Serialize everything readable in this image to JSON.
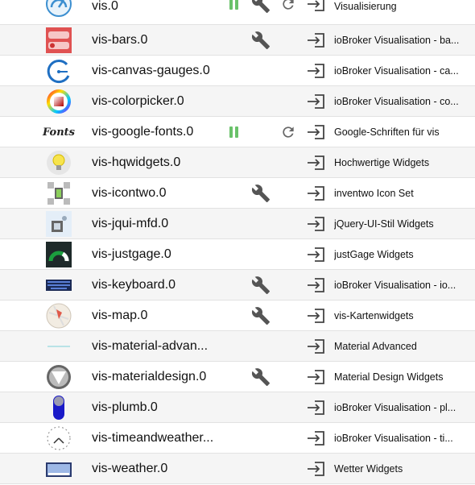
{
  "colors": {
    "pause": "#6ac26a",
    "icon": "#555555",
    "row_alt": "#f5f5f5"
  },
  "adapters": [
    {
      "name": "vis.0",
      "title": "Visualisierung",
      "icon": "speedometer-icon",
      "pause": true,
      "wrench": true,
      "reload": true
    },
    {
      "name": "vis-bars.0",
      "title": "ioBroker Visualisation - ba...",
      "icon": "bars-widget-icon",
      "pause": false,
      "wrench": true,
      "reload": false
    },
    {
      "name": "vis-canvas-gauges.0",
      "title": "ioBroker Visualisation - ca...",
      "icon": "canvas-gauge-icon",
      "pause": false,
      "wrench": false,
      "reload": false
    },
    {
      "name": "vis-colorpicker.0",
      "title": "ioBroker Visualisation - co...",
      "icon": "color-wheel-icon",
      "pause": false,
      "wrench": false,
      "reload": false
    },
    {
      "name": "vis-google-fonts.0",
      "title": "Google-Schriften für vis",
      "icon": "fonts-icon",
      "icon_text": "Fonts",
      "pause": true,
      "wrench": false,
      "reload": true
    },
    {
      "name": "vis-hqwidgets.0",
      "title": "Hochwertige Widgets",
      "icon": "lightbulb-icon",
      "pause": false,
      "wrench": false,
      "reload": false
    },
    {
      "name": "vis-icontwo.0",
      "title": "inventwo Icon Set",
      "icon": "icon-set-icon",
      "pause": false,
      "wrench": true,
      "reload": false
    },
    {
      "name": "vis-jqui-mfd.0",
      "title": "jQuery-UI-Stil Widgets",
      "icon": "jqui-icon",
      "pause": false,
      "wrench": false,
      "reload": false
    },
    {
      "name": "vis-justgage.0",
      "title": "justGage Widgets",
      "icon": "gauge-icon",
      "pause": false,
      "wrench": false,
      "reload": false
    },
    {
      "name": "vis-keyboard.0",
      "title": "ioBroker Visualisation - io...",
      "icon": "keyboard-icon",
      "pause": false,
      "wrench": true,
      "reload": false
    },
    {
      "name": "vis-map.0",
      "title": "vis-Kartenwidgets",
      "icon": "map-icon",
      "pause": false,
      "wrench": true,
      "reload": false
    },
    {
      "name": "vis-material-advan...",
      "title": "Material Advanced",
      "icon": "material-line-icon",
      "pause": false,
      "wrench": false,
      "reload": false
    },
    {
      "name": "vis-materialdesign.0",
      "title": "Material Design Widgets",
      "icon": "material-triangle-icon",
      "pause": false,
      "wrench": true,
      "reload": false
    },
    {
      "name": "vis-plumb.0",
      "title": "ioBroker Visualisation - pl...",
      "icon": "plumb-tube-icon",
      "pause": false,
      "wrench": false,
      "reload": false
    },
    {
      "name": "vis-timeandweather...",
      "title": "ioBroker Visualisation - ti...",
      "icon": "clock-icon",
      "pause": false,
      "wrench": false,
      "reload": false
    },
    {
      "name": "vis-weather.0",
      "title": "Wetter Widgets",
      "icon": "weather-icon",
      "pause": false,
      "wrench": false,
      "reload": false
    }
  ]
}
